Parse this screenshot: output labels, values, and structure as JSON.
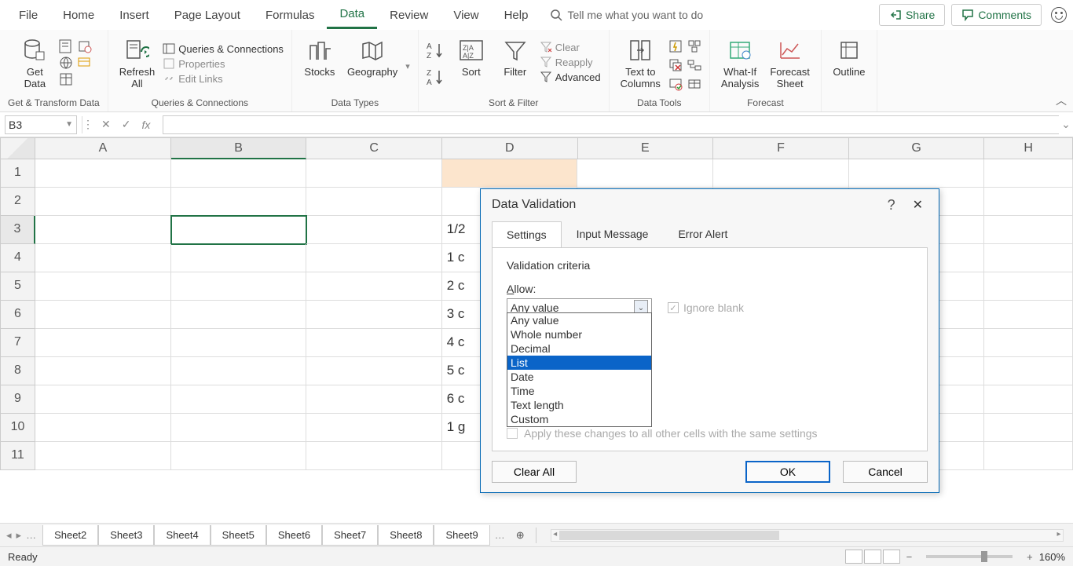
{
  "menu": {
    "tabs": [
      "File",
      "Home",
      "Insert",
      "Page Layout",
      "Formulas",
      "Data",
      "Review",
      "View",
      "Help"
    ],
    "active": "Data",
    "tell_me": "Tell me what you want to do",
    "share": "Share",
    "comments": "Comments"
  },
  "ribbon": {
    "get_data": "Get\nData",
    "group_get": "Get & Transform Data",
    "refresh": "Refresh\nAll",
    "queries": "Queries & Connections",
    "properties": "Properties",
    "edit_links": "Edit Links",
    "group_queries": "Queries & Connections",
    "stocks": "Stocks",
    "geography": "Geography",
    "group_types": "Data Types",
    "sort": "Sort",
    "filter": "Filter",
    "clear": "Clear",
    "reapply": "Reapply",
    "advanced": "Advanced",
    "group_sortfilter": "Sort & Filter",
    "text_to_columns": "Text to\nColumns",
    "group_tools": "Data Tools",
    "whatif": "What-If\nAnalysis",
    "forecast": "Forecast\nSheet",
    "group_forecast": "Forecast",
    "outline": "Outline"
  },
  "formula_bar": {
    "namebox": "B3",
    "fx": "fx"
  },
  "columns": [
    "A",
    "B",
    "C",
    "D",
    "E",
    "F",
    "G",
    "H"
  ],
  "rows": [
    "1",
    "2",
    "3",
    "4",
    "5",
    "6",
    "7",
    "8",
    "9",
    "10",
    "11"
  ],
  "active_cell": "B3",
  "cells": {
    "D1": "",
    "D3": "1/2",
    "D4": "1 c",
    "D5": "2 c",
    "D6": "3 c",
    "D7": "4 c",
    "D8": "5 c",
    "D9": "6 c",
    "D10": "1 g"
  },
  "dialog": {
    "title": "Data Validation",
    "tabs": [
      "Settings",
      "Input Message",
      "Error Alert"
    ],
    "active_tab": "Settings",
    "criteria": "Validation criteria",
    "allow": "Allow:",
    "allow_value": "Any value",
    "ignore_blank": "Ignore blank",
    "options": [
      "Any value",
      "Whole number",
      "Decimal",
      "List",
      "Date",
      "Time",
      "Text length",
      "Custom"
    ],
    "selected_option": "List",
    "apply": "Apply these changes to all other cells with the same settings",
    "clear_all": "Clear All",
    "ok": "OK",
    "cancel": "Cancel"
  },
  "sheets": [
    "Sheet2",
    "Sheet3",
    "Sheet4",
    "Sheet5",
    "Sheet6",
    "Sheet7",
    "Sheet8",
    "Sheet9"
  ],
  "status": {
    "ready": "Ready",
    "zoom": "160%"
  }
}
